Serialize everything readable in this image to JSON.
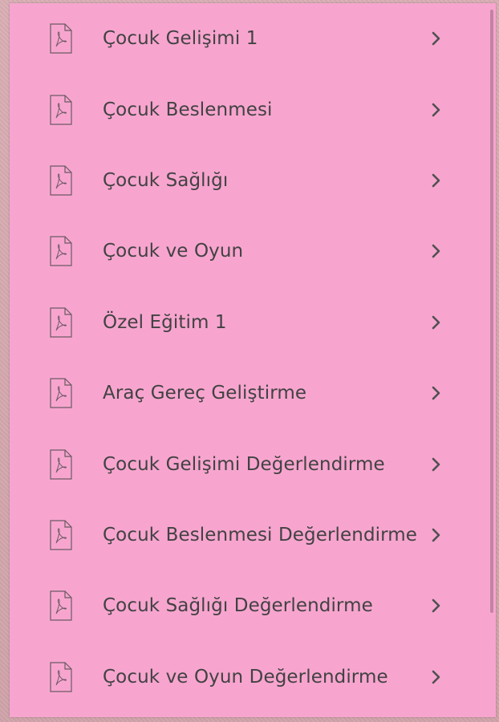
{
  "colors": {
    "panel": "#f7a5cf",
    "text": "#424242",
    "icon_stroke": "#6b5b63",
    "chevron": "#505050"
  },
  "list": {
    "icon": "pdf-document-icon",
    "chevron_icon": "chevron-right-icon",
    "items": [
      {
        "label": "Çocuk Gelişimi 1"
      },
      {
        "label": "Çocuk Beslenmesi"
      },
      {
        "label": "Çocuk Sağlığı"
      },
      {
        "label": "Çocuk ve Oyun"
      },
      {
        "label": "Özel Eğitim 1"
      },
      {
        "label": "Araç Gereç Geliştirme"
      },
      {
        "label": "Çocuk Gelişimi Değerlendirme"
      },
      {
        "label": "Çocuk Beslenmesi Değerlendirme"
      },
      {
        "label": "Çocuk Sağlığı Değerlendirme"
      },
      {
        "label": "Çocuk ve Oyun Değerlendirme"
      }
    ]
  }
}
